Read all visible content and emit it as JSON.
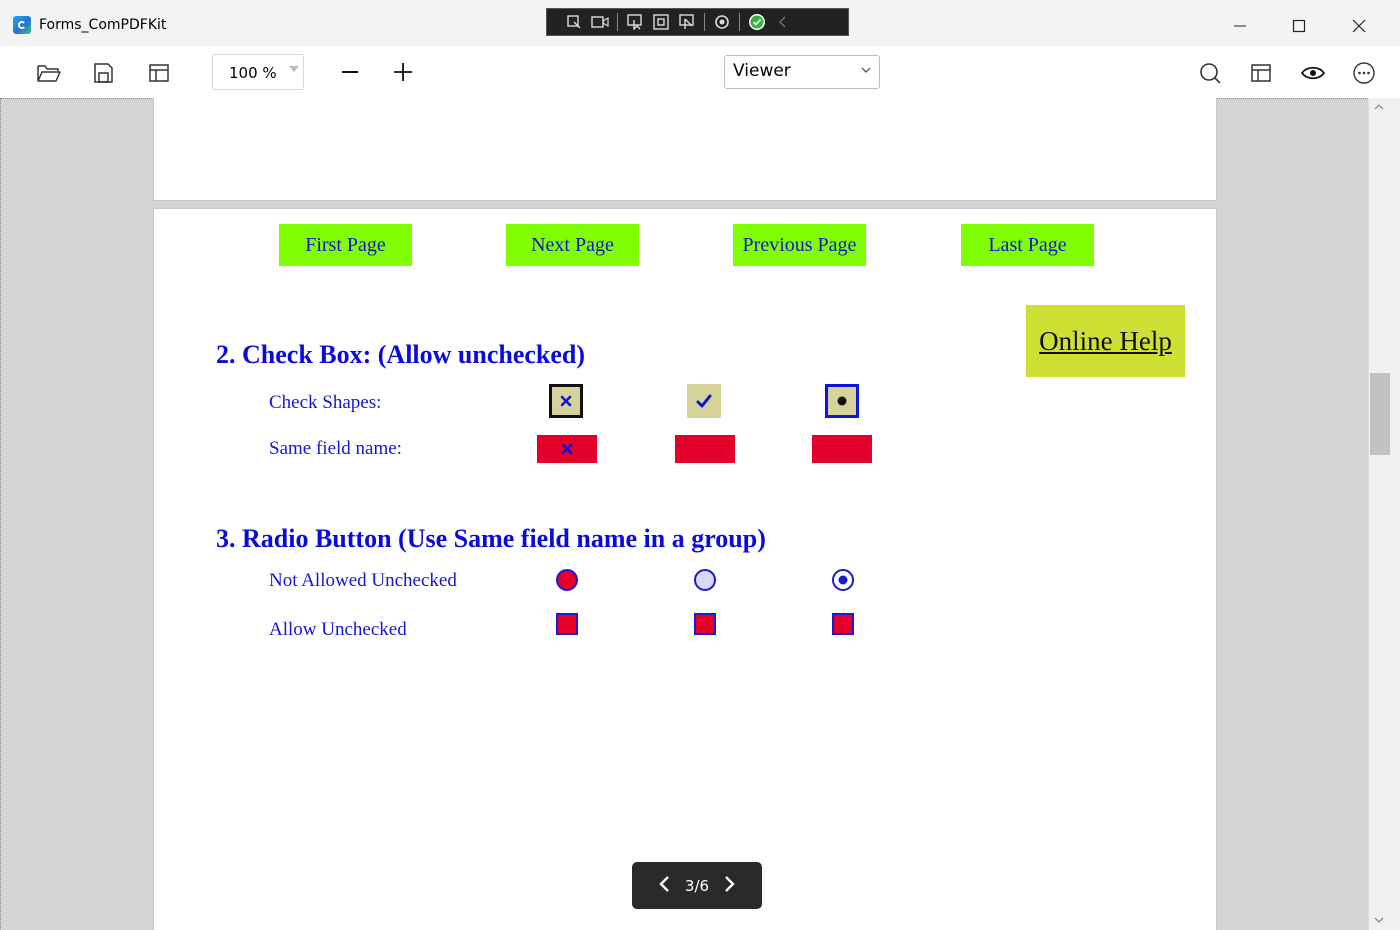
{
  "window": {
    "title": "Forms_ComPDFKit",
    "controls": [
      "minimize-icon",
      "maximize-icon",
      "close-icon"
    ]
  },
  "toolbar": {
    "zoom_value": "100 %",
    "view_mode": "Viewer",
    "left_icons": [
      "open-folder-icon",
      "save-icon",
      "layout-panel-icon"
    ],
    "right_icons": [
      "search-icon",
      "layout-panel-icon",
      "eye-icon",
      "more-icon"
    ]
  },
  "document": {
    "nav_buttons": [
      "First Page",
      "Next Page",
      "Previous Page",
      "Last Page"
    ],
    "help_button": "Online Help",
    "section2": {
      "heading": "2. Check Box: (Allow unchecked)",
      "row1_label": "Check Shapes:",
      "row2_label": "Same field name:",
      "check_shapes": [
        "cross",
        "check",
        "circle"
      ],
      "same_field_states": [
        "checked",
        "unchecked",
        "unchecked"
      ]
    },
    "section3": {
      "heading": "3. Radio Button (Use Same field name in a group)",
      "row1_label": "Not Allowed Unchecked",
      "row2_label": "Allow Unchecked"
    }
  },
  "pager": {
    "text": "3/6"
  },
  "colors": {
    "nav_button_bg": "#7fff00",
    "help_button_bg": "#cde033",
    "text_blue": "#0a0adf",
    "field_red": "#e4002b",
    "check_bg": "#d6d29c"
  }
}
